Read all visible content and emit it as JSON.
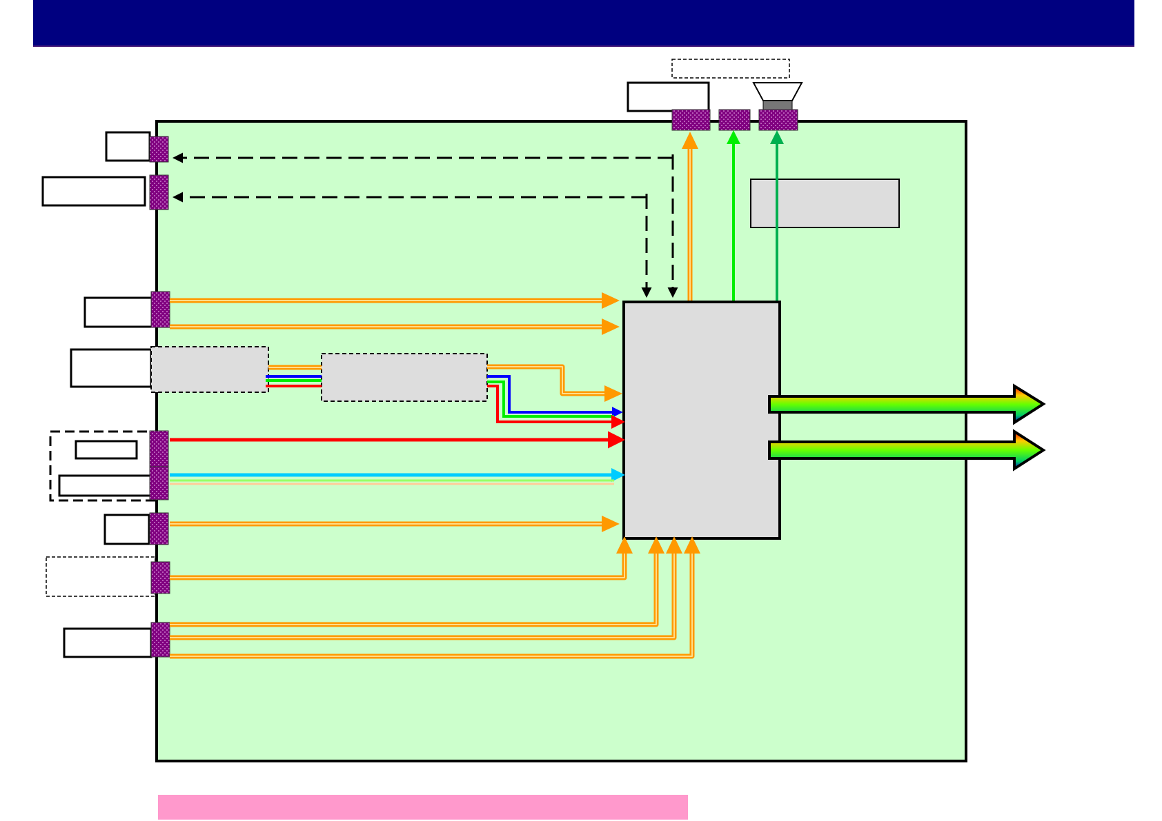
{
  "colors": {
    "header": "#000080",
    "board": "#ccffcc",
    "port": "#800080",
    "block_fill": "#dddddd",
    "footer_note": "#ff99cc",
    "signal_orange": "#ff9900",
    "signal_red": "#ff0000",
    "signal_blue": "#0000ff",
    "signal_green": "#00ff00",
    "signal_cyan": "#00ccff",
    "signal_darkgreen": "#00b050"
  },
  "icons": {
    "speaker": "speaker-icon",
    "output_arrow": "rainbow-arrow-icon"
  }
}
